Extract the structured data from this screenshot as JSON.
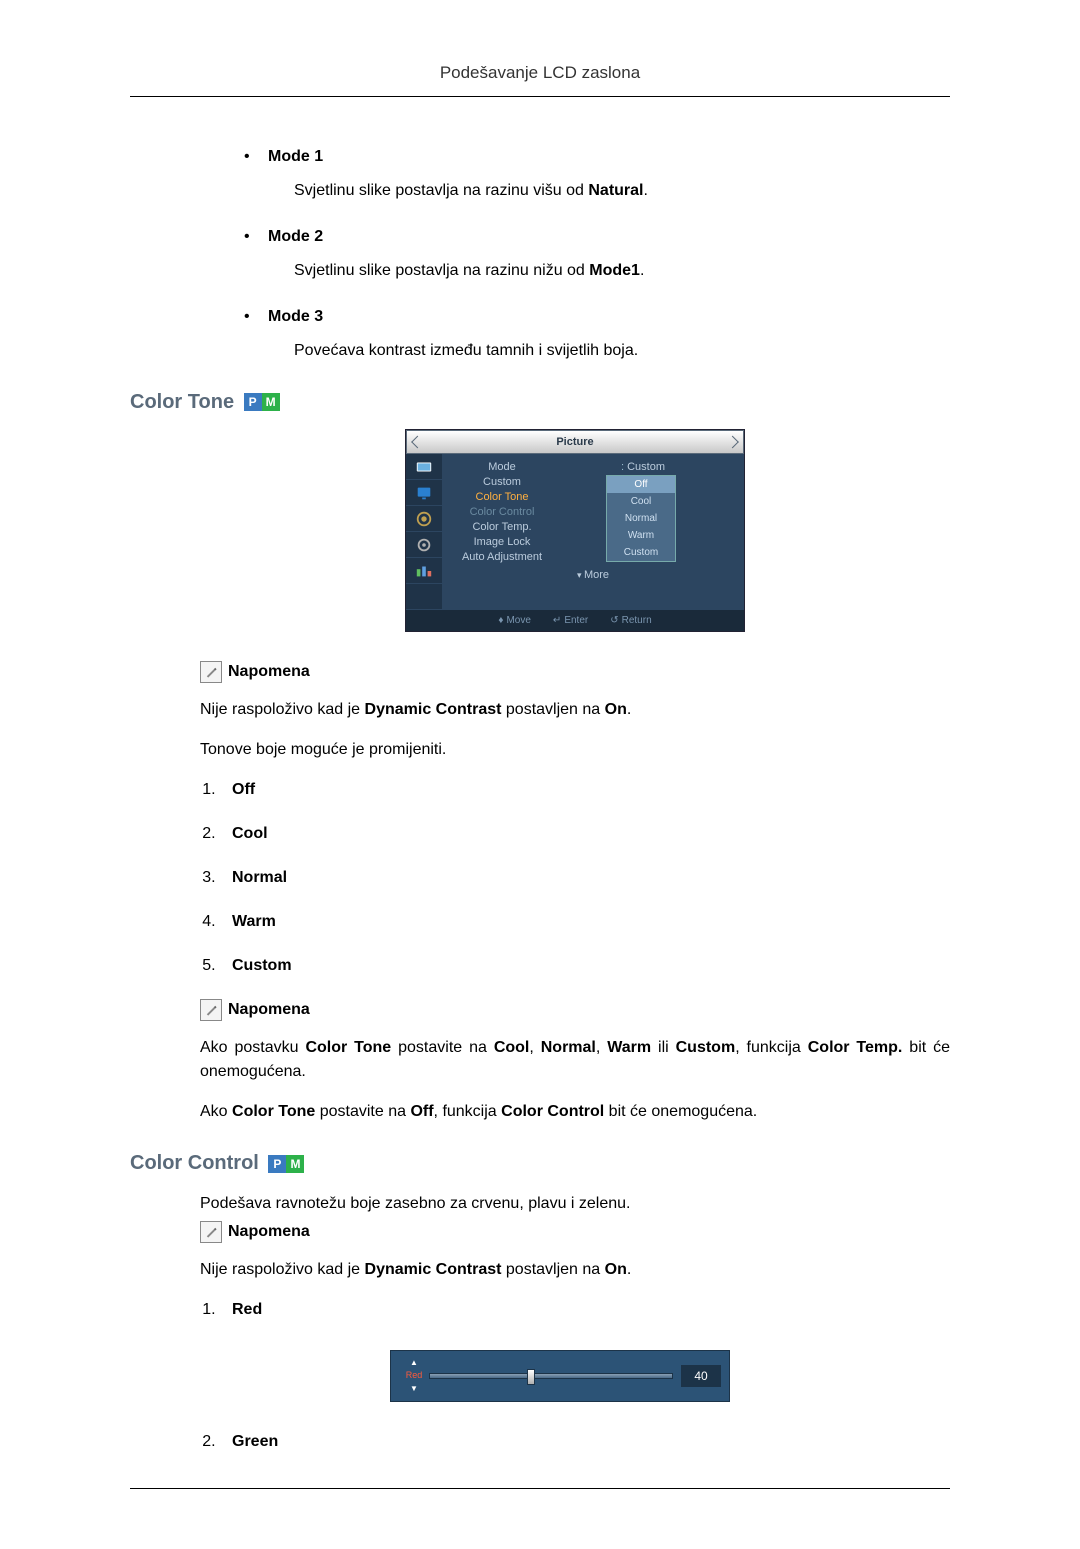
{
  "header": {
    "title": "Podešavanje LCD zaslona"
  },
  "modes": {
    "items": [
      {
        "label": "Mode 1",
        "desc_a": "Svjetlinu slike postavlja na razinu višu od ",
        "desc_b": "Natural",
        "desc_c": "."
      },
      {
        "label": "Mode 2",
        "desc_a": "Svjetlinu slike postavlja na razinu nižu od ",
        "desc_b": "Mode1",
        "desc_c": "."
      },
      {
        "label": "Mode 3",
        "desc_a": "Povećava kontrast između tamnih i svijetlih boja.",
        "desc_b": "",
        "desc_c": ""
      }
    ]
  },
  "color_tone": {
    "heading": "Color Tone",
    "osd": {
      "title": "Picture",
      "rows": {
        "mode": {
          "label": "Mode",
          "value": "Custom"
        },
        "custom": {
          "label": "Custom"
        },
        "color_tone": {
          "label": "Color Tone"
        },
        "color_control": {
          "label": "Color Control"
        },
        "color_temp": {
          "label": "Color Temp."
        },
        "image_lock": {
          "label": "Image Lock"
        },
        "auto_adj": {
          "label": "Auto Adjustment"
        },
        "more": {
          "label": "More"
        }
      },
      "dropdown": [
        "Off",
        "Cool",
        "Normal",
        "Warm",
        "Custom"
      ],
      "footer": {
        "move": "Move",
        "enter": "Enter",
        "return": "Return"
      }
    },
    "note1": {
      "label": "Napomena",
      "p1_a": "Nije raspoloživo kad je ",
      "p1_b": "Dynamic Contrast",
      "p1_c": " postavljen na ",
      "p1_d": "On",
      "p1_e": ".",
      "p2": "Tonove boje moguće je promijeniti."
    },
    "options": [
      "Off",
      "Cool",
      "Normal",
      "Warm",
      "Custom"
    ],
    "note2": {
      "label": "Napomena",
      "p1_a": "Ako postavku ",
      "p1_b": "Color Tone",
      "p1_c": " postavite na ",
      "p1_d": "Cool",
      "p1_e": ", ",
      "p1_f": "Normal",
      "p1_g": ", ",
      "p1_h": "Warm",
      "p1_i": " ili ",
      "p1_j": "Custom",
      "p1_k": ", funkcija ",
      "p1_l": "Color Temp.",
      "p1_m": " bit će onemogućena.",
      "p2_a": "Ako ",
      "p2_b": "Color Tone",
      "p2_c": " postavite na ",
      "p2_d": "Off",
      "p2_e": ", funkcija ",
      "p2_f": "Color Control",
      "p2_g": " bit će onemogućena."
    }
  },
  "color_control": {
    "heading": "Color Control",
    "intro": "Podešava ravnotežu boje zasebno za crvenu, plavu i zelenu.",
    "note": {
      "label": "Napomena",
      "p1_a": "Nije raspoloživo kad je ",
      "p1_b": "Dynamic Contrast",
      "p1_c": " postavljen na ",
      "p1_d": "On",
      "p1_e": "."
    },
    "items": {
      "red": {
        "label": "Red",
        "slider_label": "Red",
        "value": "40",
        "pos_pct": 40
      },
      "green": {
        "label": "Green"
      }
    }
  }
}
